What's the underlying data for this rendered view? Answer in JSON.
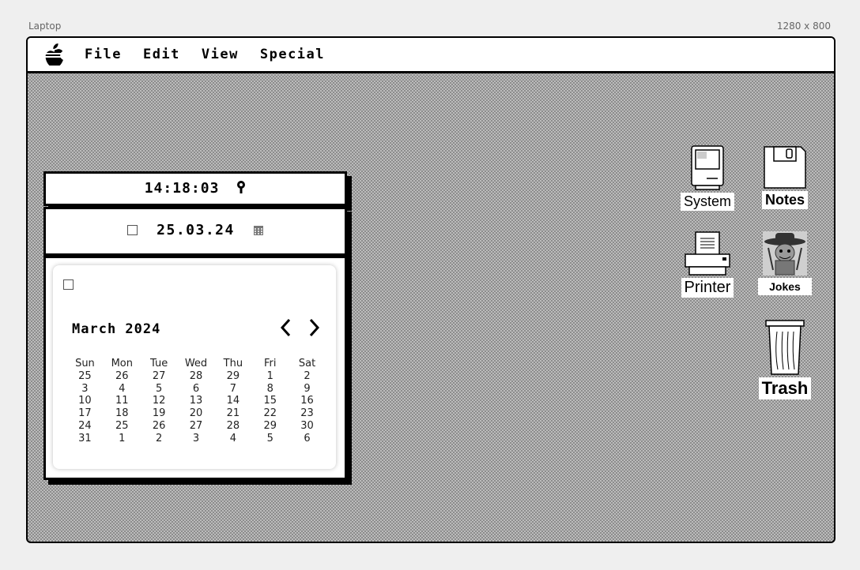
{
  "frame": {
    "device_label": "Laptop",
    "resolution_label": "1280 x 800"
  },
  "menubar": {
    "items": [
      {
        "label": "File"
      },
      {
        "label": "Edit"
      },
      {
        "label": "View"
      },
      {
        "label": "Special"
      }
    ]
  },
  "clock": {
    "time": "14:18:03"
  },
  "date": {
    "value": "25.03.24"
  },
  "calendar": {
    "month_label": "March 2024",
    "weekdays": [
      "Sun",
      "Mon",
      "Tue",
      "Wed",
      "Thu",
      "Fri",
      "Sat"
    ],
    "weeks": [
      [
        "25",
        "26",
        "27",
        "28",
        "29",
        "1",
        "2"
      ],
      [
        "3",
        "4",
        "5",
        "6",
        "7",
        "8",
        "9"
      ],
      [
        "10",
        "11",
        "12",
        "13",
        "14",
        "15",
        "16"
      ],
      [
        "17",
        "18",
        "19",
        "20",
        "21",
        "22",
        "23"
      ],
      [
        "24",
        "25",
        "26",
        "27",
        "28",
        "29",
        "30"
      ],
      [
        "31",
        "1",
        "2",
        "3",
        "4",
        "5",
        "6"
      ]
    ]
  },
  "desktop_icons": {
    "system": "System",
    "notes": "Notes",
    "printer": "Printer",
    "jokes": "Jokes",
    "trash": "Trash"
  }
}
